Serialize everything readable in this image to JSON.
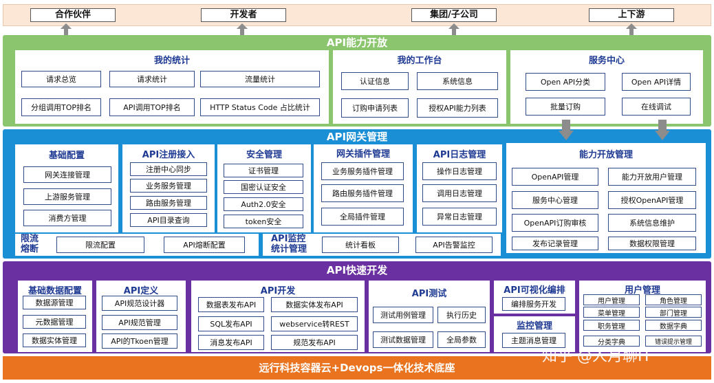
{
  "top": {
    "partners": "合作伙伴",
    "developers": "开发者",
    "group": "集团/子公司",
    "updown": "上下游"
  },
  "open": {
    "title": "API能力开放",
    "stats": {
      "title": "我的统计",
      "items": [
        "请求总览",
        "请求统计",
        "流量统计",
        "分组调用TOP排名",
        "API调用TOP排名",
        "HTTP Status Code 占比统计"
      ]
    },
    "workbench": {
      "title": "我的工作台",
      "items": [
        "认证信息",
        "系统信息",
        "订购申请列表",
        "授权API能力列表"
      ]
    },
    "service": {
      "title": "服务中心",
      "items": [
        "Open API分类",
        "Open API详情",
        "批量订购",
        "在线调试"
      ]
    }
  },
  "gateway": {
    "title": "API网关管理",
    "basic": {
      "title": "基础配置",
      "items": [
        "网关连接管理",
        "上游服务管理",
        "消费方管理"
      ]
    },
    "register": {
      "title": "API注册接入",
      "items": [
        "注册中心同步",
        "业务服务管理",
        "路由服务管理",
        "API目录查询"
      ]
    },
    "security": {
      "title": "安全管理",
      "items": [
        "证书管理",
        "国密认证安全",
        "Auth2.0安全",
        "token安全"
      ]
    },
    "plugins": {
      "title": "网关插件管理",
      "items": [
        "业务服务插件管理",
        "路由服务插件管理",
        "全局插件管理"
      ]
    },
    "logs": {
      "title": "API日志管理",
      "items": [
        "操作日志管理",
        "调用日志管理",
        "异常日志管理"
      ]
    },
    "capability": {
      "title": "能力开放管理",
      "items": [
        "OpenAPI管理",
        "能力开放用户管理",
        "服务中心管理",
        "授权OpenAPI管理",
        "OpenAPI订购审核",
        "系统信息维护",
        "发布记录管理",
        "数据权限管理"
      ]
    },
    "limit": {
      "title1": "限流",
      "title2": "熔断",
      "items": [
        "限流配置",
        "API熔断配置"
      ]
    },
    "monitor": {
      "title1": "API监控",
      "title2": "统计管理",
      "items": [
        "统计看板",
        "API告警监控"
      ]
    }
  },
  "dev": {
    "title": "API快速开发",
    "basicdata": {
      "title": "基础数据配置",
      "items": [
        "数据源管理",
        "元数据管理",
        "数据实体管理"
      ]
    },
    "define": {
      "title": "API定义",
      "items": [
        "API规范设计器",
        "API规范管理",
        "API的Tkoen管理"
      ]
    },
    "develop": {
      "title": "API开发",
      "items": [
        "数据表发布API",
        "数据实体发布API",
        "SQL发布API",
        "webservice转REST",
        "消息发布API",
        "规范发布API"
      ]
    },
    "test": {
      "title": "API测试",
      "items": [
        "测试用例管理",
        "执行历史",
        "测试数据管理",
        "全局参数"
      ]
    },
    "visual": {
      "title": "API可视化编排",
      "items": [
        "编排服务开发"
      ]
    },
    "monitoring": {
      "title": "监控管理",
      "items": [
        "主题消息管理"
      ]
    },
    "users": {
      "title": "用户管理",
      "items": [
        "用户管理",
        "角色管理",
        "菜单管理",
        "部门管理",
        "职务管理",
        "数据字典",
        "分类字典",
        "错误提示管理"
      ]
    }
  },
  "bottom": "远行科技容器云+Devops一体化技术底座",
  "watermark": "知乎 @人月聊IT",
  "colors": {
    "green": "#8bc56e",
    "blue": "#1a8fd6",
    "purple": "#6a2fa0",
    "orange": "#e9731f",
    "peach": "#fce6d6"
  }
}
